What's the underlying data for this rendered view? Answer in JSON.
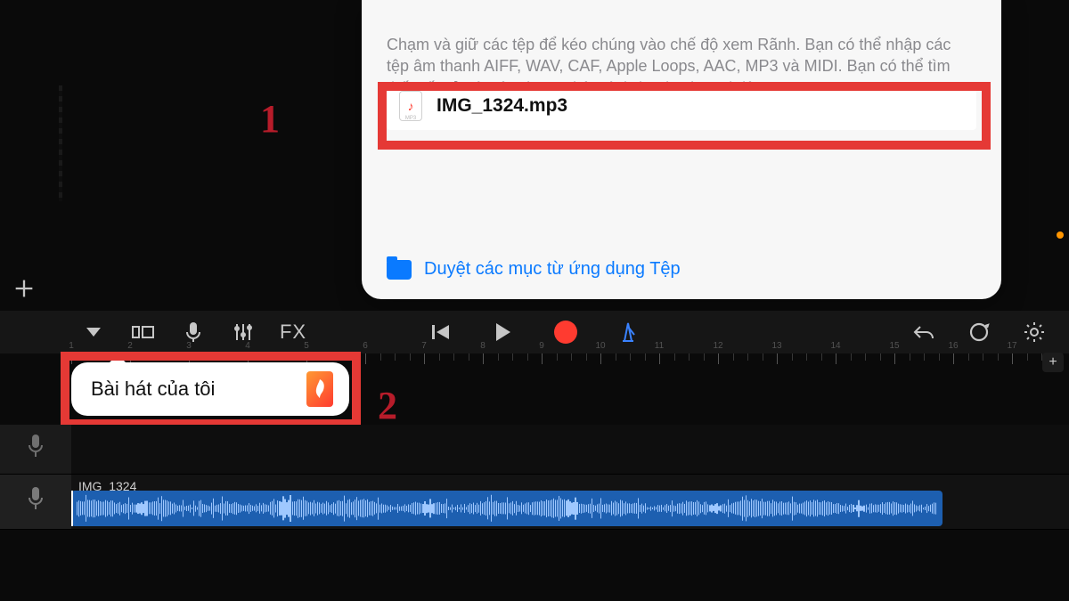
{
  "file_popover": {
    "help_text": "Chạm và giữ các tệp để kéo chúng vào chế độ xem Rãnh. Bạn có thể nhập các tệp âm thanh AIFF, WAV, CAF, Apple Loops, AAC, MP3 và MIDI. Bạn có thể tìm thấy tất cả các tệp được nhập từ iCloud Drive tại đây",
    "file_name": "IMG_1324.mp3",
    "browse_label": "Duyệt các mục từ ứng dụng Tệp"
  },
  "annotations": {
    "step1": "1",
    "step2": "2"
  },
  "toolbar": {
    "fx_label": "FX"
  },
  "track_popover": {
    "title": "Bài hát của tôi"
  },
  "audio_clip": {
    "label": "IMG_1324"
  },
  "ruler": {
    "start": 1,
    "count": 17,
    "spacing": 66
  }
}
